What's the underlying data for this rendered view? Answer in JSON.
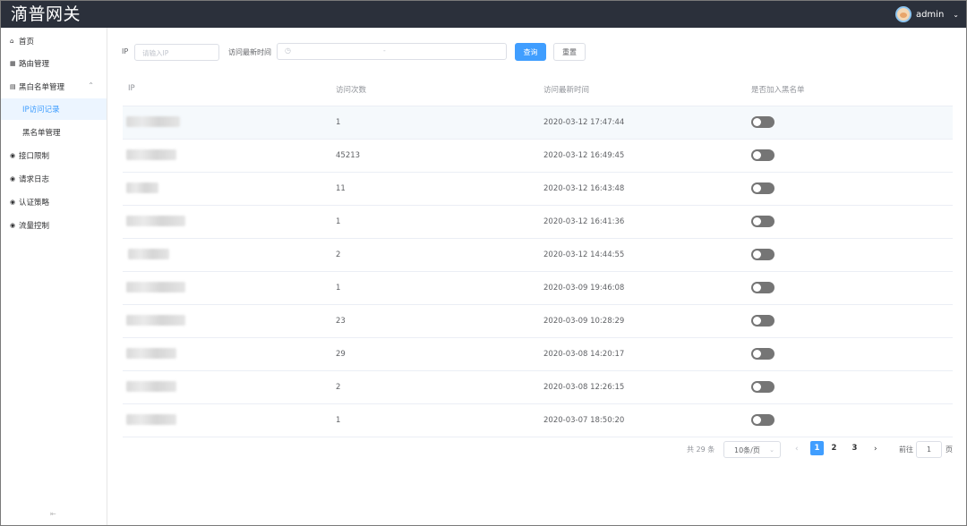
{
  "header": {
    "logo": "滴普网关",
    "username": "admin"
  },
  "sidebar": {
    "items": [
      {
        "icon": "home-icon",
        "glyph": "⌂",
        "label": "首页"
      },
      {
        "icon": "grid-icon",
        "glyph": "▦",
        "label": "路由管理"
      },
      {
        "icon": "list-icon",
        "glyph": "▤",
        "label": "黑白名单管理",
        "expanded": true
      },
      {
        "label": "IP访问记录",
        "active": true
      },
      {
        "label": "黑名单管理"
      },
      {
        "icon": "stack-icon",
        "glyph": "◉",
        "label": "接口限制"
      },
      {
        "icon": "stack-icon",
        "glyph": "◉",
        "label": "请求日志"
      },
      {
        "icon": "stack-icon",
        "glyph": "◉",
        "label": "认证策略"
      },
      {
        "icon": "stack-icon",
        "glyph": "◉",
        "label": "流量控制"
      }
    ]
  },
  "filter": {
    "ip_label": "IP",
    "ip_placeholder": "请输入IP",
    "time_label": "访问最新时间",
    "range_separator": "-",
    "search_button": "查询",
    "reset_button": "重置"
  },
  "table": {
    "headers": [
      "IP",
      "访问次数",
      "访问最新时间",
      "是否加入黑名单"
    ],
    "rows": [
      {
        "count": "1",
        "time": "2020-03-12 17:47:44",
        "blacklisted": false
      },
      {
        "count": "45213",
        "time": "2020-03-12 16:49:45",
        "blacklisted": false
      },
      {
        "count": "11",
        "time": "2020-03-12 16:43:48",
        "blacklisted": false
      },
      {
        "count": "1",
        "time": "2020-03-12 16:41:36",
        "blacklisted": false
      },
      {
        "count": "2",
        "time": "2020-03-12 14:44:55",
        "blacklisted": false
      },
      {
        "count": "1",
        "time": "2020-03-09 19:46:08",
        "blacklisted": false
      },
      {
        "count": "23",
        "time": "2020-03-09 10:28:29",
        "blacklisted": false
      },
      {
        "count": "29",
        "time": "2020-03-08 14:20:17",
        "blacklisted": false
      },
      {
        "count": "2",
        "time": "2020-03-08 12:26:15",
        "blacklisted": false
      },
      {
        "count": "1",
        "time": "2020-03-07 18:50:20",
        "blacklisted": false
      }
    ]
  },
  "pagination": {
    "total": "共 29 条",
    "page_size": "10条/页",
    "pages": [
      "1",
      "2",
      "3"
    ],
    "current_page": "1",
    "goto_label": "前往",
    "goto_value": "1",
    "page_unit": "页"
  },
  "colors": {
    "header_bg": "#2b303b",
    "primary": "#409eff",
    "switch_off": "#757575"
  }
}
